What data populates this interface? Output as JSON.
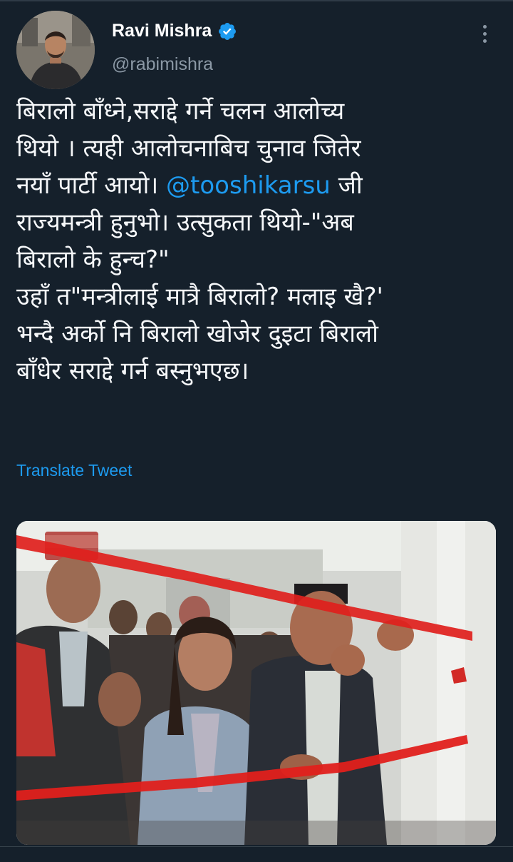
{
  "tweet": {
    "author": {
      "display_name": "Ravi Mishra",
      "handle": "@rabimishra",
      "verified": true
    },
    "text_lines": [
      {
        "text": "बिरालो बाँध्ने,सराद्दे गर्ने चलन आलोच्य"
      },
      {
        "text": "थियो । त्यही आलोचनाबिच चुनाव जितेर"
      },
      {
        "before": "नयाँ पार्टी आयो। ",
        "mention": "@tooshikarsu",
        "after": " जी"
      },
      {
        "text": "राज्यमन्त्री हुनुभो। उत्सुकता थियो-\"अब"
      },
      {
        "text": "बिरालो के हुन्च?\""
      },
      {
        "text": "उहाँ त\"मन्त्रीलाई मात्रै बिरालो? मलाइ खै?'"
      },
      {
        "text": "भन्दै अर्को नि बिरालो खोजेर दुइटा बिरालो"
      },
      {
        "text": "बाँधेर सराद्दे गर्न बस्नुभएछ।"
      }
    ],
    "translate_label": "Translate Tweet"
  },
  "icons": {
    "verified": "verified-badge-icon",
    "more": "more-vertical-icon"
  },
  "colors": {
    "background": "#15202b",
    "link": "#1d9bf0",
    "secondary_text": "#8b98a5",
    "verified_badge": "#1d9bf0",
    "ribbon": "#e0201c"
  }
}
